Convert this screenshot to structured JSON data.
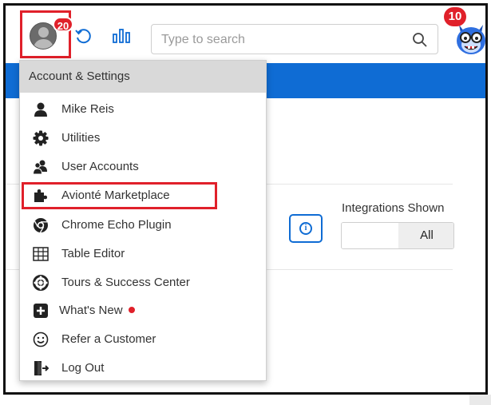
{
  "header": {
    "notification_count": "20",
    "search_placeholder": "Type to search",
    "mascot_badge": "10"
  },
  "panel": {
    "integrations_label": "Integrations Shown",
    "toggle_selected": "All"
  },
  "menu": {
    "title": "Account & Settings",
    "items": [
      {
        "label": "Mike Reis",
        "icon": "user-icon"
      },
      {
        "label": "Utilities",
        "icon": "gear-icon"
      },
      {
        "label": "User Accounts",
        "icon": "users-icon"
      },
      {
        "label": "Avionté Marketplace",
        "icon": "puzzle-icon"
      },
      {
        "label": "Chrome Echo Plugin",
        "icon": "chrome-icon"
      },
      {
        "label": "Table Editor",
        "icon": "table-icon"
      },
      {
        "label": "Tours & Success Center",
        "icon": "lifebuoy-icon"
      },
      {
        "label": "What's New",
        "icon": "plus-square-icon"
      },
      {
        "label": "Refer a Customer",
        "icon": "smile-icon"
      },
      {
        "label": "Log Out",
        "icon": "logout-icon"
      }
    ]
  },
  "colors": {
    "brand_blue": "#0f6cd4",
    "highlight_red": "#e0202a"
  }
}
